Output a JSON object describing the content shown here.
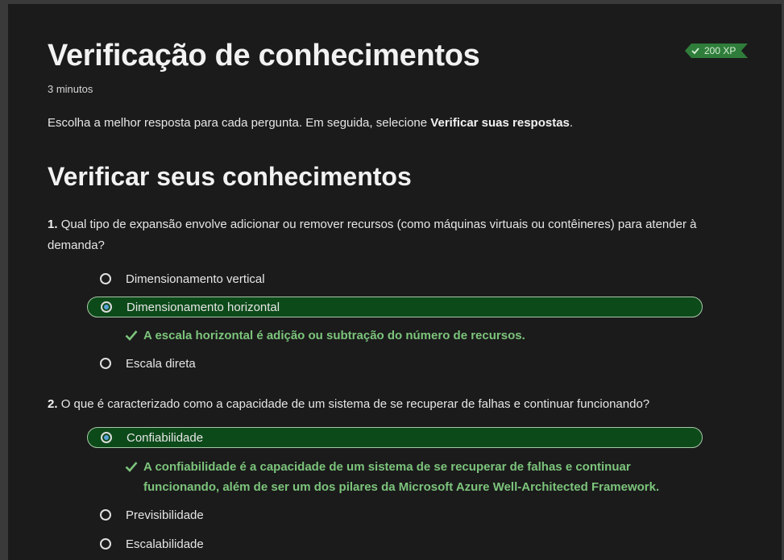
{
  "header": {
    "title": "Verificação de conhecimentos",
    "duration": "3 minutos",
    "xp_badge": "200 XP"
  },
  "intro": {
    "text": "Escolha a melhor resposta para cada pergunta. Em seguida, selecione ",
    "bold": "Verificar suas respostas",
    "end": "."
  },
  "section_title": "Verificar seus conhecimentos",
  "questions": [
    {
      "number": "1.",
      "text": "Qual tipo de expansão envolve adicionar ou remover recursos (como máquinas virtuais ou contêineres) para atender à demanda?",
      "options": [
        {
          "label": "Dimensionamento vertical",
          "selected": false
        },
        {
          "label": "Dimensionamento horizontal",
          "selected": true
        },
        {
          "label": "Escala direta",
          "selected": false
        }
      ],
      "feedback": "A escala horizontal é adição ou subtração do número de recursos."
    },
    {
      "number": "2.",
      "text": "O que é caracterizado como a capacidade de um sistema de se recuperar de falhas e continuar funcionando?",
      "options": [
        {
          "label": "Confiabilidade",
          "selected": true
        },
        {
          "label": "Previsibilidade",
          "selected": false
        },
        {
          "label": "Escalabilidade",
          "selected": false
        }
      ],
      "feedback": "A confiabilidade é a capacidade de um sistema de se recuperar de falhas e continuar funcionando, além de ser um dos pilares da Microsoft Azure Well-Architected Framework."
    }
  ],
  "colors": {
    "background": "#1b1b1b",
    "selected_option": "#0d4a1a",
    "feedback_text": "#7cc47c",
    "xp_badge": "#2f7d3a"
  },
  "icons": {
    "xp": "check-icon",
    "feedback": "checkmark-icon",
    "option": "radio-icon"
  }
}
